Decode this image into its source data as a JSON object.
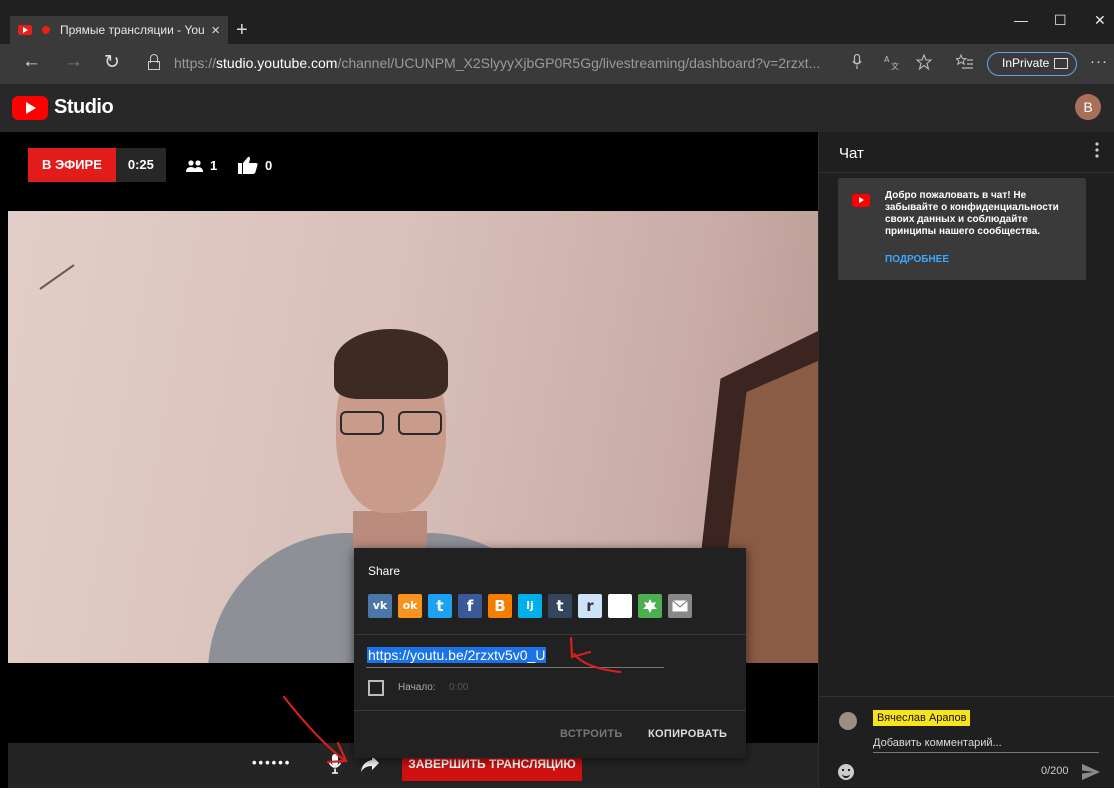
{
  "browser": {
    "tab_title": "Прямые трансляции - YouTube",
    "tab_close": "×",
    "new_tab": "+",
    "win_min": "—",
    "win_max": "☐",
    "win_close": "✕",
    "nav_back": "←",
    "nav_forward": "→",
    "nav_refresh": "↻",
    "url_prefix": "https://",
    "url_domain": "studio.youtube.com",
    "url_path": "/channel/UCUNPM_X2SlyyyXjbGP0R5Gg/livestreaming/dashboard?v=2rzxt...",
    "inprivate_label": "InPrivate",
    "more": "···"
  },
  "studio": {
    "logo_text": "Studio",
    "avatar_letter": "B"
  },
  "stream": {
    "live_label": "В ЭФИРЕ",
    "elapsed": "0:25",
    "viewers": "1",
    "likes": "0"
  },
  "controls": {
    "dots": "••••••",
    "end_label": "ЗАВЕРШИТЬ ТРАНСЛЯЦИЮ"
  },
  "chat": {
    "title": "Чат",
    "menu": "⋮",
    "welcome_text": "Добро пожаловать в чат! Не забывайте о конфиденциальности своих данных и соблюдайте принципы нашего сообщества.",
    "welcome_link": "ПОДРОБНЕЕ",
    "author": "Вячеслав Арапов",
    "input_placeholder": "Добавить комментарий...",
    "counter": "0/200"
  },
  "share": {
    "title": "Share",
    "services": [
      {
        "name": "vk",
        "glyph": "vk",
        "color": "#4a76a8"
      },
      {
        "name": "odnoklassniki",
        "glyph": "ok",
        "color": "#f7931e"
      },
      {
        "name": "twitter",
        "glyph": "t",
        "color": "#1da1f2"
      },
      {
        "name": "facebook",
        "glyph": "f",
        "color": "#3b5998"
      },
      {
        "name": "blogger",
        "glyph": "B",
        "color": "#f57d00"
      },
      {
        "name": "livejournal",
        "glyph": "lj",
        "color": "#00b0ea"
      },
      {
        "name": "tumblr",
        "glyph": "t",
        "color": "#35465c"
      },
      {
        "name": "reddit",
        "glyph": "r",
        "color": "#cee3f8"
      },
      {
        "name": "blank",
        "glyph": "",
        "color": "#ffffff"
      },
      {
        "name": "pinterest",
        "glyph": "",
        "color": "#4caf50"
      },
      {
        "name": "email",
        "glyph": "",
        "color": "#888888"
      }
    ],
    "url": "https://youtu.be/2rzxtv5v0_U",
    "start_label": "Начало:",
    "start_time": "0:00",
    "embed_label": "ВСТРОИТЬ",
    "copy_label": "КОПИРОВАТЬ"
  },
  "colors": {
    "accent_red": "#e21b1b",
    "link_blue": "#3ea6ff",
    "selection": "#1a73e8",
    "annotation": "#d61f1f"
  }
}
